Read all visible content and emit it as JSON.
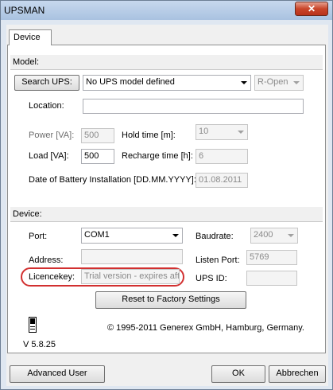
{
  "window": {
    "title": "UPSMAN",
    "close_glyph": "✕"
  },
  "tab": {
    "label": "Device"
  },
  "model_section": {
    "header": "Model:"
  },
  "search_ups": {
    "label": "Search UPS:"
  },
  "ups_model": {
    "value": "No UPS model defined"
  },
  "ropen": {
    "value": "R-Open"
  },
  "location": {
    "label": "Location:",
    "value": ""
  },
  "power": {
    "label": "Power [VA]:",
    "value": "500"
  },
  "hold_time": {
    "label": "Hold time [m]:",
    "value": "10"
  },
  "load": {
    "label": "Load [VA]:",
    "value": "500"
  },
  "recharge_time": {
    "label": "Recharge time [h]:",
    "value": "6"
  },
  "battery_date": {
    "label": "Date of Battery Installation [DD.MM.YYYY]:",
    "value": "01.08.2011"
  },
  "device_section": {
    "header": "Device:"
  },
  "port": {
    "label": "Port:",
    "value": "COM1"
  },
  "baudrate": {
    "label": "Baudrate:",
    "value": "2400"
  },
  "address": {
    "label": "Address:",
    "value": ""
  },
  "listen_port": {
    "label": "Listen Port:",
    "value": "5769"
  },
  "licencekey": {
    "label": "Licencekey:",
    "value": "Trial version - expires afte"
  },
  "ups_id": {
    "label": "UPS ID:",
    "value": ""
  },
  "reset_button": {
    "label": "Reset to Factory Settings"
  },
  "about": {
    "copyright": "© 1995-2011 Generex GmbH, Hamburg, Germany.",
    "version": "V 5.8.25"
  },
  "footer": {
    "advanced_user": "Advanced User",
    "ok": "OK",
    "cancel": "Abbrechen"
  },
  "colors": {
    "highlight_oval": "#d23030",
    "title_bar": "#b4cae6"
  }
}
